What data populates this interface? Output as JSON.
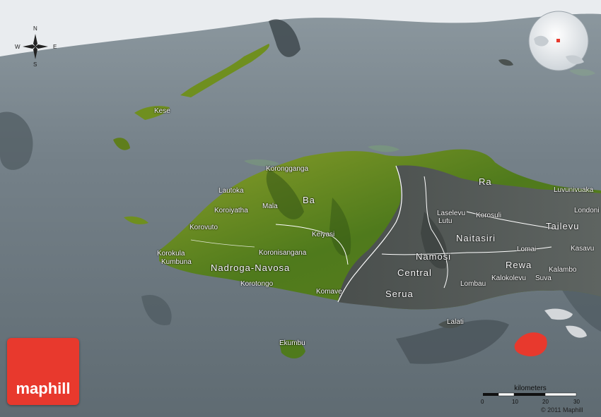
{
  "compass": {
    "n": "N",
    "s": "S",
    "e": "E",
    "w": "W"
  },
  "places": [
    {
      "name": "Kese"
    },
    {
      "name": "Korongganga"
    },
    {
      "name": "Lautoka"
    },
    {
      "name": "Ba"
    },
    {
      "name": "Mala"
    },
    {
      "name": "Koroiyatha"
    },
    {
      "name": "Korovuto"
    },
    {
      "name": "Keiyasi"
    },
    {
      "name": "Korokula"
    },
    {
      "name": "Kumbuna"
    },
    {
      "name": "Koronisangana"
    },
    {
      "name": "Nadroga-Navosa"
    },
    {
      "name": "Korotongo"
    },
    {
      "name": "Komave"
    },
    {
      "name": "Ekumbu"
    },
    {
      "name": "Ra"
    },
    {
      "name": "Luvunivuaka"
    },
    {
      "name": "Londoni"
    },
    {
      "name": "Laselevu"
    },
    {
      "name": "Lutu"
    },
    {
      "name": "Korosuli"
    },
    {
      "name": "Tailevu"
    },
    {
      "name": "Naitasiri"
    },
    {
      "name": "Lomai"
    },
    {
      "name": "Kasavu"
    },
    {
      "name": "Namosi"
    },
    {
      "name": "Central"
    },
    {
      "name": "Rewa"
    },
    {
      "name": "Kalambo"
    },
    {
      "name": "Kalokolevu"
    },
    {
      "name": "Suva"
    },
    {
      "name": "Serua"
    },
    {
      "name": "Lombau"
    },
    {
      "name": "Lalati"
    }
  ],
  "scale": {
    "title": "kilometers",
    "ticks": [
      "0",
      "10",
      "20",
      "30"
    ]
  },
  "brand": {
    "logo_text": "maphill",
    "copyright": "© 2011 Maphill"
  },
  "colors": {
    "sea": "#6b7880",
    "lowland": "#6f8f1f",
    "highland": "#3f6b1a",
    "central_division": "#4b5250",
    "highlight": "#e8392d"
  }
}
